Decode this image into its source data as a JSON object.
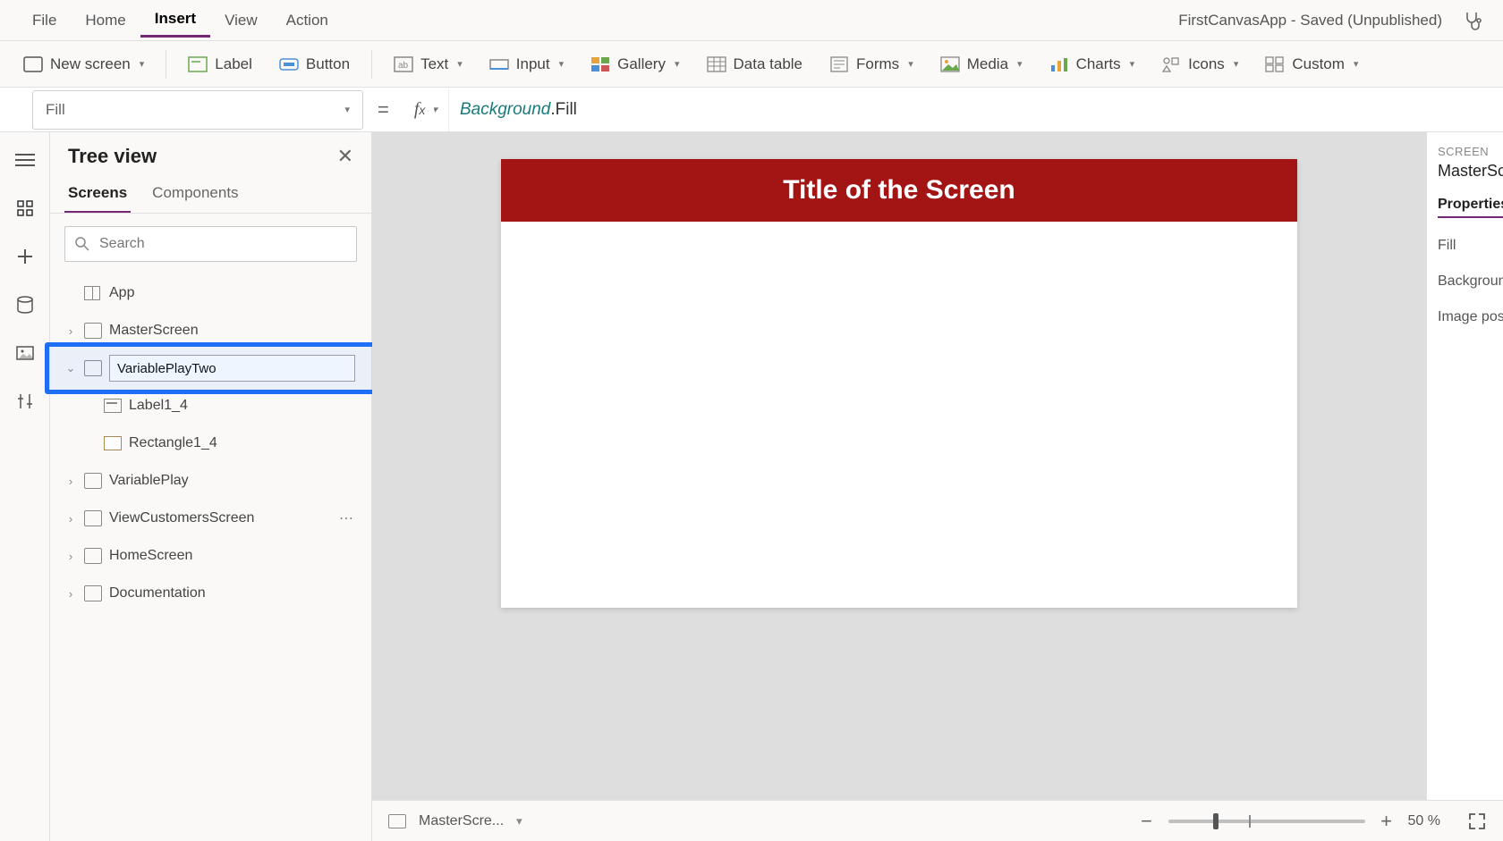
{
  "menubar": {
    "items": [
      "File",
      "Home",
      "Insert",
      "View",
      "Action"
    ],
    "active_index": 2,
    "app_title": "FirstCanvasApp - Saved (Unpublished)"
  },
  "ribbon": {
    "new_screen": "New screen",
    "label": "Label",
    "button": "Button",
    "text": "Text",
    "input": "Input",
    "gallery": "Gallery",
    "data_table": "Data table",
    "forms": "Forms",
    "media": "Media",
    "charts": "Charts",
    "icons": "Icons",
    "custom": "Custom"
  },
  "formula": {
    "property": "Fill",
    "token1": "Background",
    "token2": ".Fill"
  },
  "treeview": {
    "title": "Tree view",
    "tabs": [
      "Screens",
      "Components"
    ],
    "active_tab": 0,
    "search_placeholder": "Search",
    "app_label": "App",
    "items": [
      {
        "name": "MasterScreen",
        "expandable": true
      },
      {
        "name": "VariablePlayTwo",
        "editing": true
      },
      {
        "name": "Label1_4",
        "child": true
      },
      {
        "name": "Rectangle1_4",
        "child": true
      },
      {
        "name": "VariablePlay",
        "expandable": true
      },
      {
        "name": "ViewCustomersScreen",
        "expandable": true,
        "hover": true
      },
      {
        "name": "HomeScreen",
        "expandable": true
      },
      {
        "name": "Documentation",
        "expandable": true
      }
    ]
  },
  "canvas": {
    "title_text": "Title of the Screen",
    "title_bg": "#a31515"
  },
  "rightpanel": {
    "section": "SCREEN",
    "object": "MasterScre",
    "tab": "Properties",
    "rows": [
      "Fill",
      "Background",
      "Image posit"
    ]
  },
  "statusbar": {
    "screen_name": "MasterScre...",
    "zoom": "50",
    "zoom_unit": "%"
  }
}
